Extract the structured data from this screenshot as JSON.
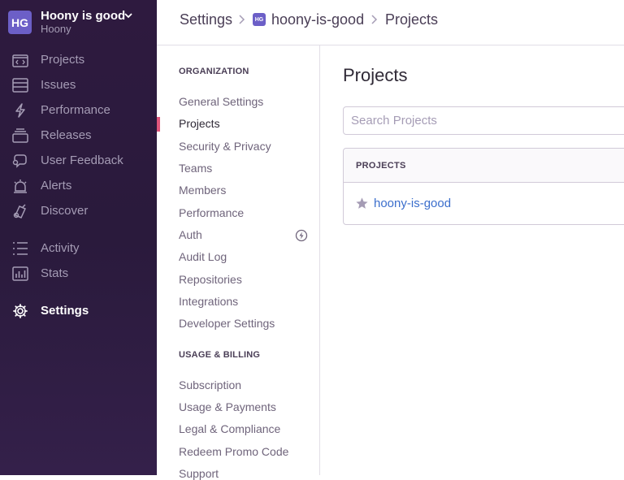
{
  "org": {
    "avatar_initials": "HG",
    "name": "Hoony is good",
    "user": "Hoony",
    "avatar_color": "#6c5fc7"
  },
  "sidebar": {
    "items": [
      {
        "label": "Projects",
        "icon": "projects-icon"
      },
      {
        "label": "Issues",
        "icon": "issues-icon"
      },
      {
        "label": "Performance",
        "icon": "performance-icon"
      },
      {
        "label": "Releases",
        "icon": "releases-icon"
      },
      {
        "label": "User Feedback",
        "icon": "user-feedback-icon"
      },
      {
        "label": "Alerts",
        "icon": "alerts-icon"
      },
      {
        "label": "Discover",
        "icon": "discover-icon"
      },
      {
        "label": "Activity",
        "icon": "activity-icon"
      },
      {
        "label": "Stats",
        "icon": "stats-icon"
      },
      {
        "label": "Settings",
        "icon": "settings-icon",
        "active": true
      }
    ]
  },
  "breadcrumb": {
    "root": "Settings",
    "org_badge": "HG",
    "org": "hoony-is-good",
    "current": "Projects"
  },
  "settings_nav": {
    "organization_heading": "ORGANIZATION",
    "organization_items": [
      "General Settings",
      "Projects",
      "Security & Privacy",
      "Teams",
      "Members",
      "Performance",
      "Auth",
      "Audit Log",
      "Repositories",
      "Integrations",
      "Developer Settings"
    ],
    "active_item": "Projects",
    "billing_heading": "USAGE & BILLING",
    "billing_items": [
      "Subscription",
      "Usage & Payments",
      "Legal & Compliance",
      "Redeem Promo Code",
      "Support"
    ]
  },
  "main": {
    "title": "Projects",
    "search_placeholder": "Search Projects",
    "panel_header": "PROJECTS",
    "projects": [
      {
        "name": "hoony-is-good",
        "starred": false
      }
    ]
  },
  "colors": {
    "sidebar_bg": "#2e1a3f",
    "accent": "#6c5fc7",
    "active_marker": "#e1567c",
    "link": "#3b6ecc"
  }
}
